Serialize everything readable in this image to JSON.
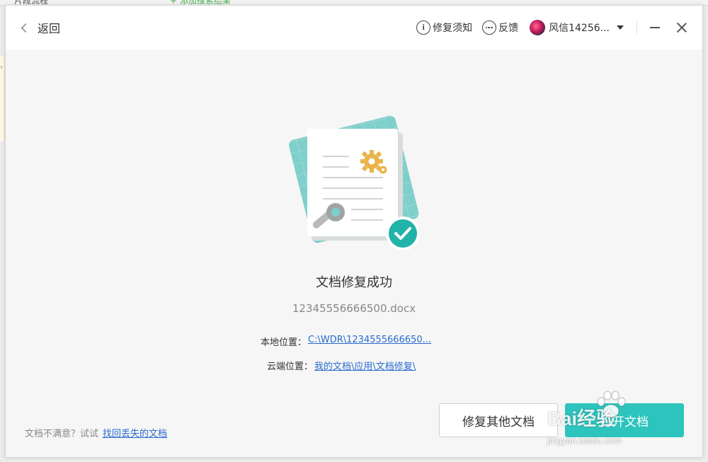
{
  "background": {
    "left_text": "片段流程",
    "green_text": "+ 添加搜索结果"
  },
  "titlebar": {
    "back_label": "返回",
    "repair_notice_label": "修复须知",
    "feedback_label": "反馈",
    "username": "风信14256..."
  },
  "main": {
    "title": "文档修复成功",
    "filename": "12345556666500.docx",
    "local_label": "本地位置：",
    "local_path": "C:\\WDR\\1234555666650...",
    "cloud_label": "云端位置：",
    "cloud_path": "我的文档\\应用\\文档修复\\"
  },
  "footer": {
    "tip_text": "文档不满意？试试",
    "tip_link": "找回丢失的文档",
    "other_button": "修复其他文档",
    "open_button": "打开文档"
  },
  "watermark": {
    "main": "Bai经验",
    "sub": "jingyan.baidu.com"
  },
  "colors": {
    "accent": "#2dc4bd",
    "link": "#2a6bd1"
  }
}
